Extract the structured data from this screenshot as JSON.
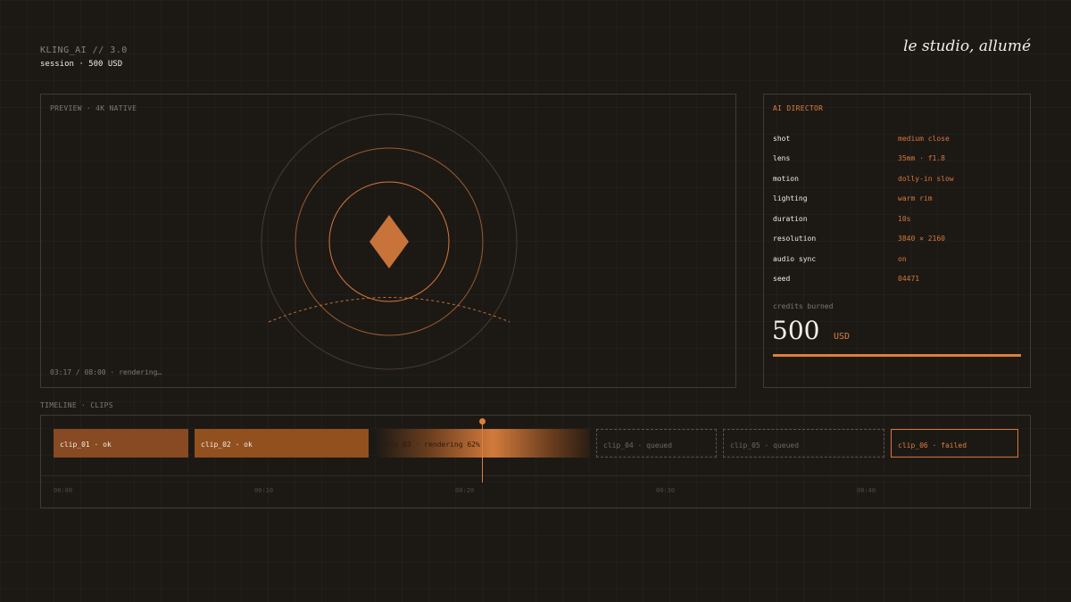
{
  "header": {
    "brand": "KLING_AI // 3.0",
    "session": "session · 500 USD",
    "tagline": "le studio, allumé"
  },
  "preview": {
    "label": "PREVIEW · 4K NATIVE",
    "status": "03:17 / 08:00 · rendering…"
  },
  "director": {
    "label": "AI DIRECTOR",
    "specs": [
      {
        "key": "shot",
        "value": "medium close"
      },
      {
        "key": "lens",
        "value": "35mm · f1.8"
      },
      {
        "key": "motion",
        "value": "dolly-in slow"
      },
      {
        "key": "lighting",
        "value": "warm rim"
      },
      {
        "key": "duration",
        "value": "10s"
      },
      {
        "key": "resolution",
        "value": "3840 × 2160"
      },
      {
        "key": "audio sync",
        "value": "on"
      },
      {
        "key": "seed",
        "value": "04471"
      }
    ],
    "credits_label": "credits burned",
    "credits_amount": "500",
    "credits_unit": "USD",
    "credits_fraction": 1.0
  },
  "timeline": {
    "title": "TIMELINE · CLIPS",
    "clips": [
      {
        "label": "clip_01 · ok",
        "status": "ok"
      },
      {
        "label": "clip_02 · ok",
        "status": "ok"
      },
      {
        "label": "clip_03 · rendering 62%",
        "status": "rendering",
        "progress": 0.62
      },
      {
        "label": "clip_04 · queued",
        "status": "queued"
      },
      {
        "label": "clip_05 · queued",
        "status": "queued"
      },
      {
        "label": "clip_06 · failed",
        "status": "failed"
      }
    ],
    "ticks": [
      "00:00",
      "00:10",
      "00:20",
      "00:30",
      "00:40"
    ]
  },
  "colors": {
    "accent": "#dd7e3d",
    "background": "#1c1915",
    "clip_ok": "#874a22"
  },
  "icons": {
    "preview_glyph": "diamond-icon",
    "playhead": "playhead-icon"
  }
}
